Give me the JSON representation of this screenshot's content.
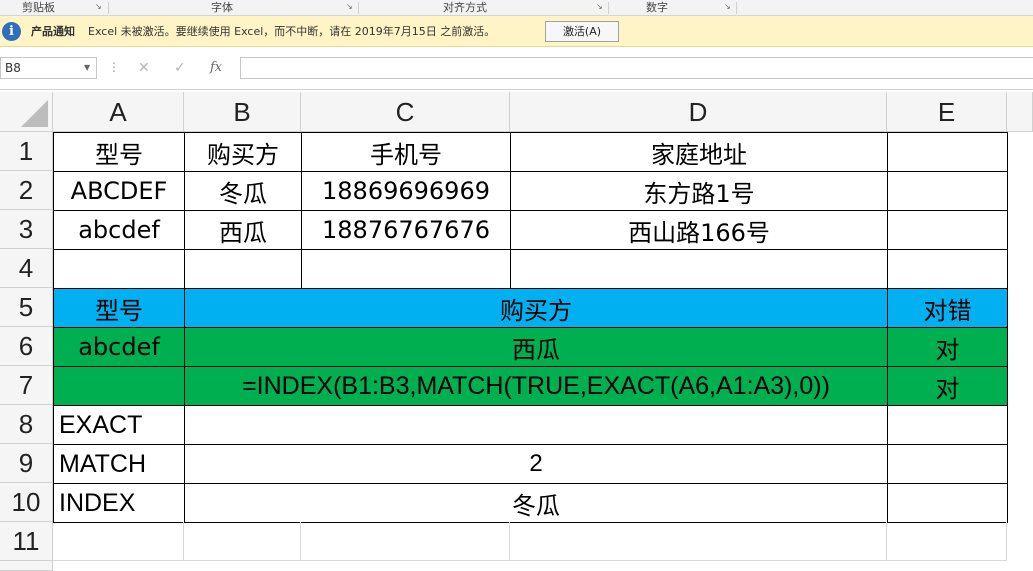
{
  "ribbon": {
    "groups": [
      "剪贴板",
      "字体",
      "对齐方式",
      "数字"
    ]
  },
  "message_bar": {
    "icon": "info-icon",
    "title": "产品通知",
    "text": "Excel 未被激活。要继续使用 Excel，而不中断，请在 2019年7月15日 之前激活。",
    "button": "激活(A)"
  },
  "formula_bar": {
    "name_box": "B8",
    "cancel_icon": "✕",
    "enter_icon": "✓",
    "fx": "fx",
    "formula": ""
  },
  "colors": {
    "header_blue": "#00b0f0",
    "header_green": "#00b050",
    "message_bar": "#fff4c6"
  },
  "sheet": {
    "columns": [
      "A",
      "B",
      "C",
      "D",
      "E"
    ],
    "rows": [
      "1",
      "2",
      "3",
      "4",
      "5",
      "6",
      "7",
      "8",
      "9",
      "10",
      "11"
    ],
    "cells": {
      "A1": "型号",
      "B1": "购买方",
      "C1": "手机号",
      "D1": "家庭地址",
      "A2": "ABCDEF",
      "B2": "冬瓜",
      "C2": "18869696969",
      "D2": "东方路1号",
      "A3": "abcdef",
      "B3": "西瓜",
      "C3": "18876767676",
      "D3": "西山路166号",
      "A5": "型号",
      "B5": "购买方",
      "E5": "对错",
      "A6": "abcdef",
      "B6": "西瓜",
      "E6": "对",
      "B7": "=INDEX(B1:B3,MATCH(TRUE,EXACT(A6,A1:A3),0))",
      "E7": "对",
      "A8": "EXACT",
      "A9": "MATCH",
      "B9": "2",
      "A10": "INDEX",
      "B10": "冬瓜"
    }
  }
}
